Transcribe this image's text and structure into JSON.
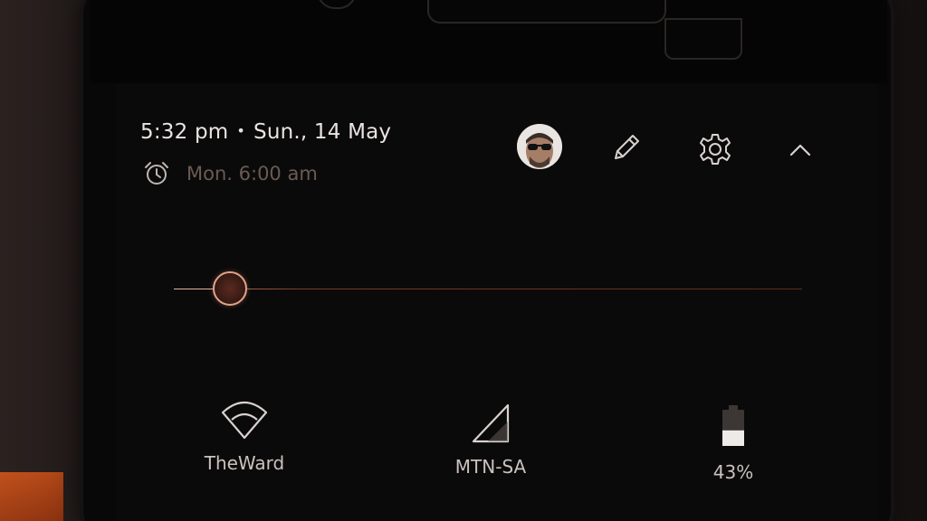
{
  "header": {
    "time": "5:32 pm",
    "separator": "•",
    "date": "Sun., 14 May",
    "alarm": "Mon. 6:00 am"
  },
  "icons": {
    "alarm": "alarm-clock-icon",
    "edit": "pencil-icon",
    "settings": "gear-icon",
    "collapse": "chevron-up-icon"
  },
  "brightness": {
    "level": 0.09
  },
  "tiles": [
    {
      "label": "TheWard",
      "icon": "wifi-icon"
    },
    {
      "label": "MTN-SA",
      "icon": "cellular-signal-icon"
    },
    {
      "label": "43%",
      "icon": "battery-icon",
      "battery_level": 0.43
    }
  ],
  "colors": {
    "accent": "#e0a48a",
    "text": "#e9e4e2",
    "muted": "#6a5a53",
    "panel": "#0b0a0a"
  }
}
